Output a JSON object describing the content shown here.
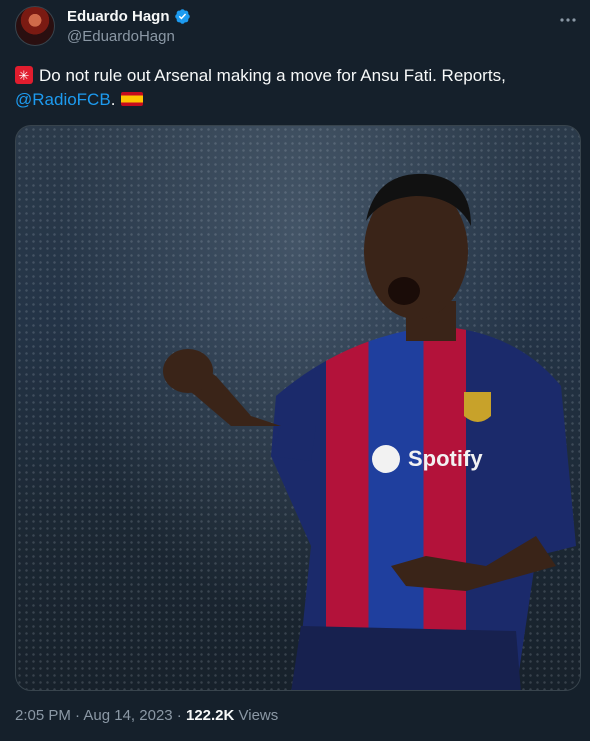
{
  "author": {
    "display_name": "Eduardo Hagn",
    "handle": "@EduardoHagn"
  },
  "tweet": {
    "text_prefix": "Do not rule out Arsenal making a move for Ansu Fati. Reports,",
    "mention": "@RadioFCB",
    "after_mention": ".",
    "emoji_alarm": "rotating-light-icon",
    "emoji_flag": "spain-flag-icon"
  },
  "media": {
    "shirt_sponsor": "Spotify"
  },
  "meta": {
    "time": "2:05 PM",
    "separator1": " · ",
    "date": "Aug 14, 2023",
    "separator2": " · ",
    "views_count": "122.2K",
    "views_label": " Views"
  },
  "colors": {
    "background": "#15202b",
    "text": "#f7f9f9",
    "secondary": "#8b98a5",
    "accent": "#1d9bf0",
    "border": "#38444d"
  }
}
